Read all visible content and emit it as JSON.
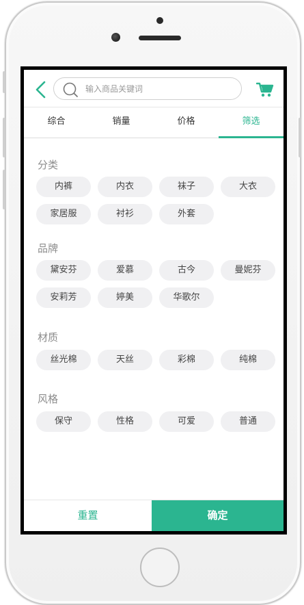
{
  "search": {
    "placeholder": "输入商品关键词",
    "value": ""
  },
  "tabs": [
    {
      "label": "综合"
    },
    {
      "label": "销量"
    },
    {
      "label": "价格"
    },
    {
      "label": "筛选",
      "active": true
    }
  ],
  "sections": [
    {
      "title": "分类",
      "options": [
        "内裤",
        "内衣",
        "袜子",
        "大衣",
        "家居服",
        "衬衫",
        "外套"
      ]
    },
    {
      "title": "品牌",
      "options": [
        "黛安芬",
        "爱慕",
        "古今",
        "曼妮芬",
        "安莉芳",
        "婷美",
        "华歌尔"
      ]
    },
    {
      "title": "材质",
      "options": [
        "丝光棉",
        "天丝",
        "彩棉",
        "纯棉"
      ]
    },
    {
      "title": "风格",
      "options": [
        "保守",
        "性格",
        "可爱",
        "普通"
      ]
    }
  ],
  "footer": {
    "reset_label": "重置",
    "confirm_label": "确定"
  },
  "colors": {
    "accent": "#2bb590",
    "chip_bg": "#f0f0f2"
  },
  "icons": {
    "back": "chevron-left-icon",
    "search": "search-icon",
    "cart": "cart-icon"
  }
}
